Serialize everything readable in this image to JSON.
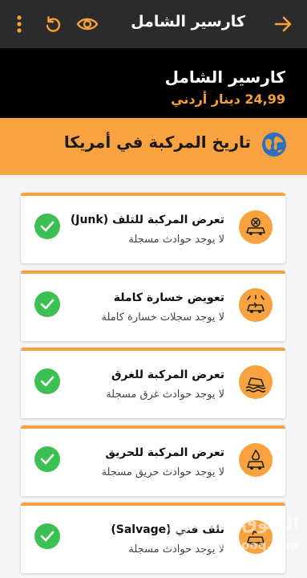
{
  "topbar": {
    "title": "كارسير الشامل",
    "icons": [
      "back-arrow-icon",
      "eye-icon",
      "refresh-icon",
      "more-vertical-icon"
    ]
  },
  "hero": {
    "name": "كارسير الشامل",
    "price": "24,99 دينار أردني"
  },
  "section": {
    "title": "تاريخ المركبة في أمريكا",
    "icon": "globe-icon"
  },
  "cards": [
    {
      "title": "تعرض المركبة للتلف (Junk)",
      "subtitle": "لا يوجد حوادث مسجلة",
      "icon": "junk-car-icon"
    },
    {
      "title": "تعويض خسارة كاملة",
      "subtitle": "لا يوجد سجلات خسارة كاملة",
      "icon": "total-loss-icon"
    },
    {
      "title": "تعرض المركبة للغرق",
      "subtitle": "لا يوجد حوادث غرق مسجلة",
      "icon": "flood-car-icon"
    },
    {
      "title": "تعرض المركبة للحريق",
      "subtitle": "لا يوجد حوادث حريق مسجلة",
      "icon": "fire-car-icon"
    },
    {
      "title": "تلف فني (Salvage)",
      "subtitle": "لا يوجد حوادث مسجلة",
      "icon": "salvage-car-icon"
    }
  ],
  "watermark": {
    "line1": "السوق المفتوح",
    "line2": "opensooq.com"
  },
  "colors": {
    "accent": "#f8a33f",
    "topbar": "#2b2b2b",
    "hero": "#000000",
    "check": "#3cbf53",
    "price": "#f7a13a"
  }
}
